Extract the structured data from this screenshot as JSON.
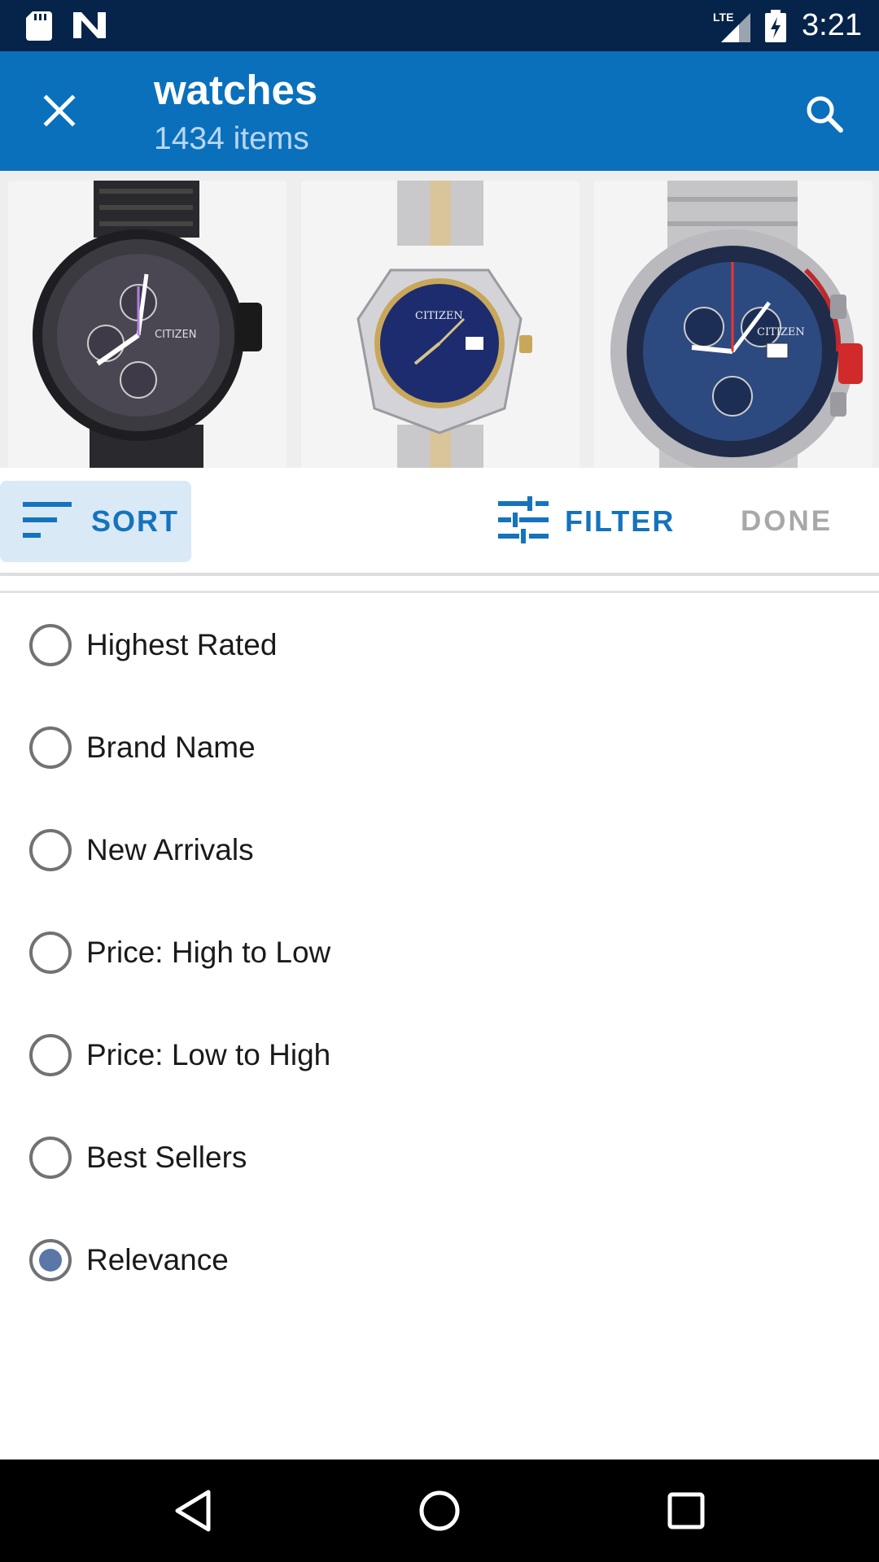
{
  "status_bar": {
    "time": "3:21",
    "network": "LTE",
    "icons": [
      "sd-card-icon",
      "n-app-icon",
      "lte-signal-icon",
      "battery-charging-icon"
    ]
  },
  "app_bar": {
    "title": "watches",
    "subtitle": "1434 items",
    "close_icon": "close-icon",
    "search_icon": "search-icon",
    "color": "#0a70bb"
  },
  "products": [
    {
      "name": "watch-product-1",
      "brand": "CITIZEN"
    },
    {
      "name": "watch-product-2",
      "brand": "CITIZEN"
    },
    {
      "name": "watch-product-3",
      "brand": "CITIZEN"
    }
  ],
  "toolbar": {
    "sort_label": "SORT",
    "filter_label": "FILTER",
    "done_label": "DONE"
  },
  "sort_options": [
    {
      "label": "Highest Rated",
      "selected": false
    },
    {
      "label": "Brand Name",
      "selected": false
    },
    {
      "label": "New Arrivals",
      "selected": false
    },
    {
      "label": "Price: High to Low",
      "selected": false
    },
    {
      "label": "Price: Low to High",
      "selected": false
    },
    {
      "label": "Best Sellers",
      "selected": false
    },
    {
      "label": "Relevance",
      "selected": true
    }
  ],
  "nav_bar": {
    "icons": [
      "back-icon",
      "home-icon",
      "recents-icon"
    ]
  }
}
